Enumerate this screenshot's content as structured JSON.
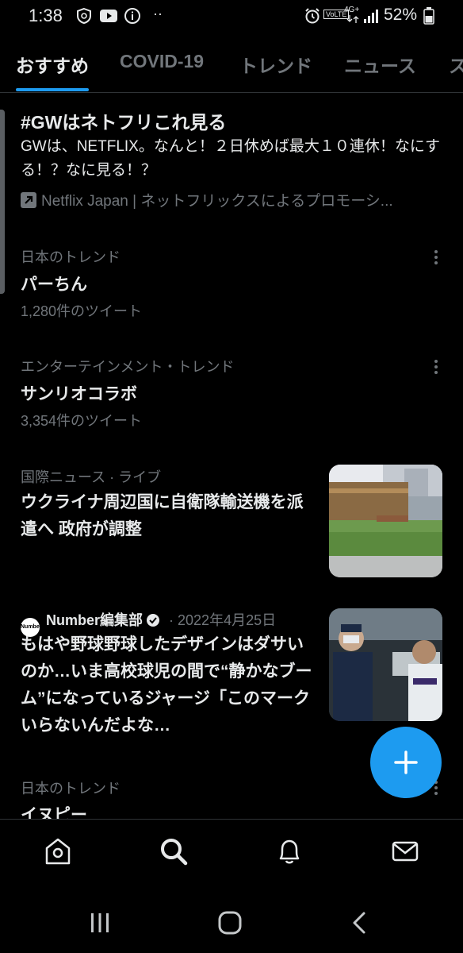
{
  "status_bar": {
    "time": "1:38",
    "left_icons": [
      "shield-icon",
      "youtube-icon",
      "info-icon",
      "more-dots-icon"
    ],
    "dots": "··",
    "battery": "52%",
    "network": "4G+",
    "volte": "VoLTE"
  },
  "tabs": [
    {
      "label": "おすすめ",
      "active": true
    },
    {
      "label": "COVID-19",
      "active": false
    },
    {
      "label": "トレンド",
      "active": false
    },
    {
      "label": "ニュース",
      "active": false
    },
    {
      "label": "ス",
      "active": false
    }
  ],
  "promoted": {
    "title": "#GWはネトフリこれ見る",
    "description": "GWは、NETFLIX。なんと！２日休めば最大１０連休！なにする！？なに見る！？",
    "promoted_by": "Netflix Japan | ネットフリックスによるプロモーシ..."
  },
  "trends": [
    {
      "category": "日本のトレンド",
      "name": "パーちん",
      "count": "1,280件のツイート"
    },
    {
      "category": "エンターテインメント・トレンド",
      "name": "サンリオコラボ",
      "count": "3,354件のツイート"
    }
  ],
  "news": [
    {
      "category": "国際ニュース",
      "status": "· ライブ",
      "title": "ウクライナ周辺国に自衛隊輸送機を派遣へ 政府が調整"
    },
    {
      "avatar_text": "Number",
      "author": "Number編集部",
      "date": "· 2022年4月25日",
      "title": "もはや野球野球したデザインはダサいのか…いま高校球児の間で“静かなブーム”になっているジャージ「このマークいらないんだよな…"
    }
  ],
  "partial_trend": {
    "category": "日本のトレンド",
    "name": "イヌピー"
  },
  "fab": {
    "icon": "plus-icon"
  },
  "bottom_nav": [
    "home-icon",
    "search-icon",
    "notifications-icon",
    "messages-icon"
  ],
  "system_nav": [
    "recents-icon",
    "home-circle-icon",
    "back-icon"
  ],
  "colors": {
    "accent": "#1d9bf0",
    "background": "#000000",
    "secondary_text": "#71767b"
  }
}
